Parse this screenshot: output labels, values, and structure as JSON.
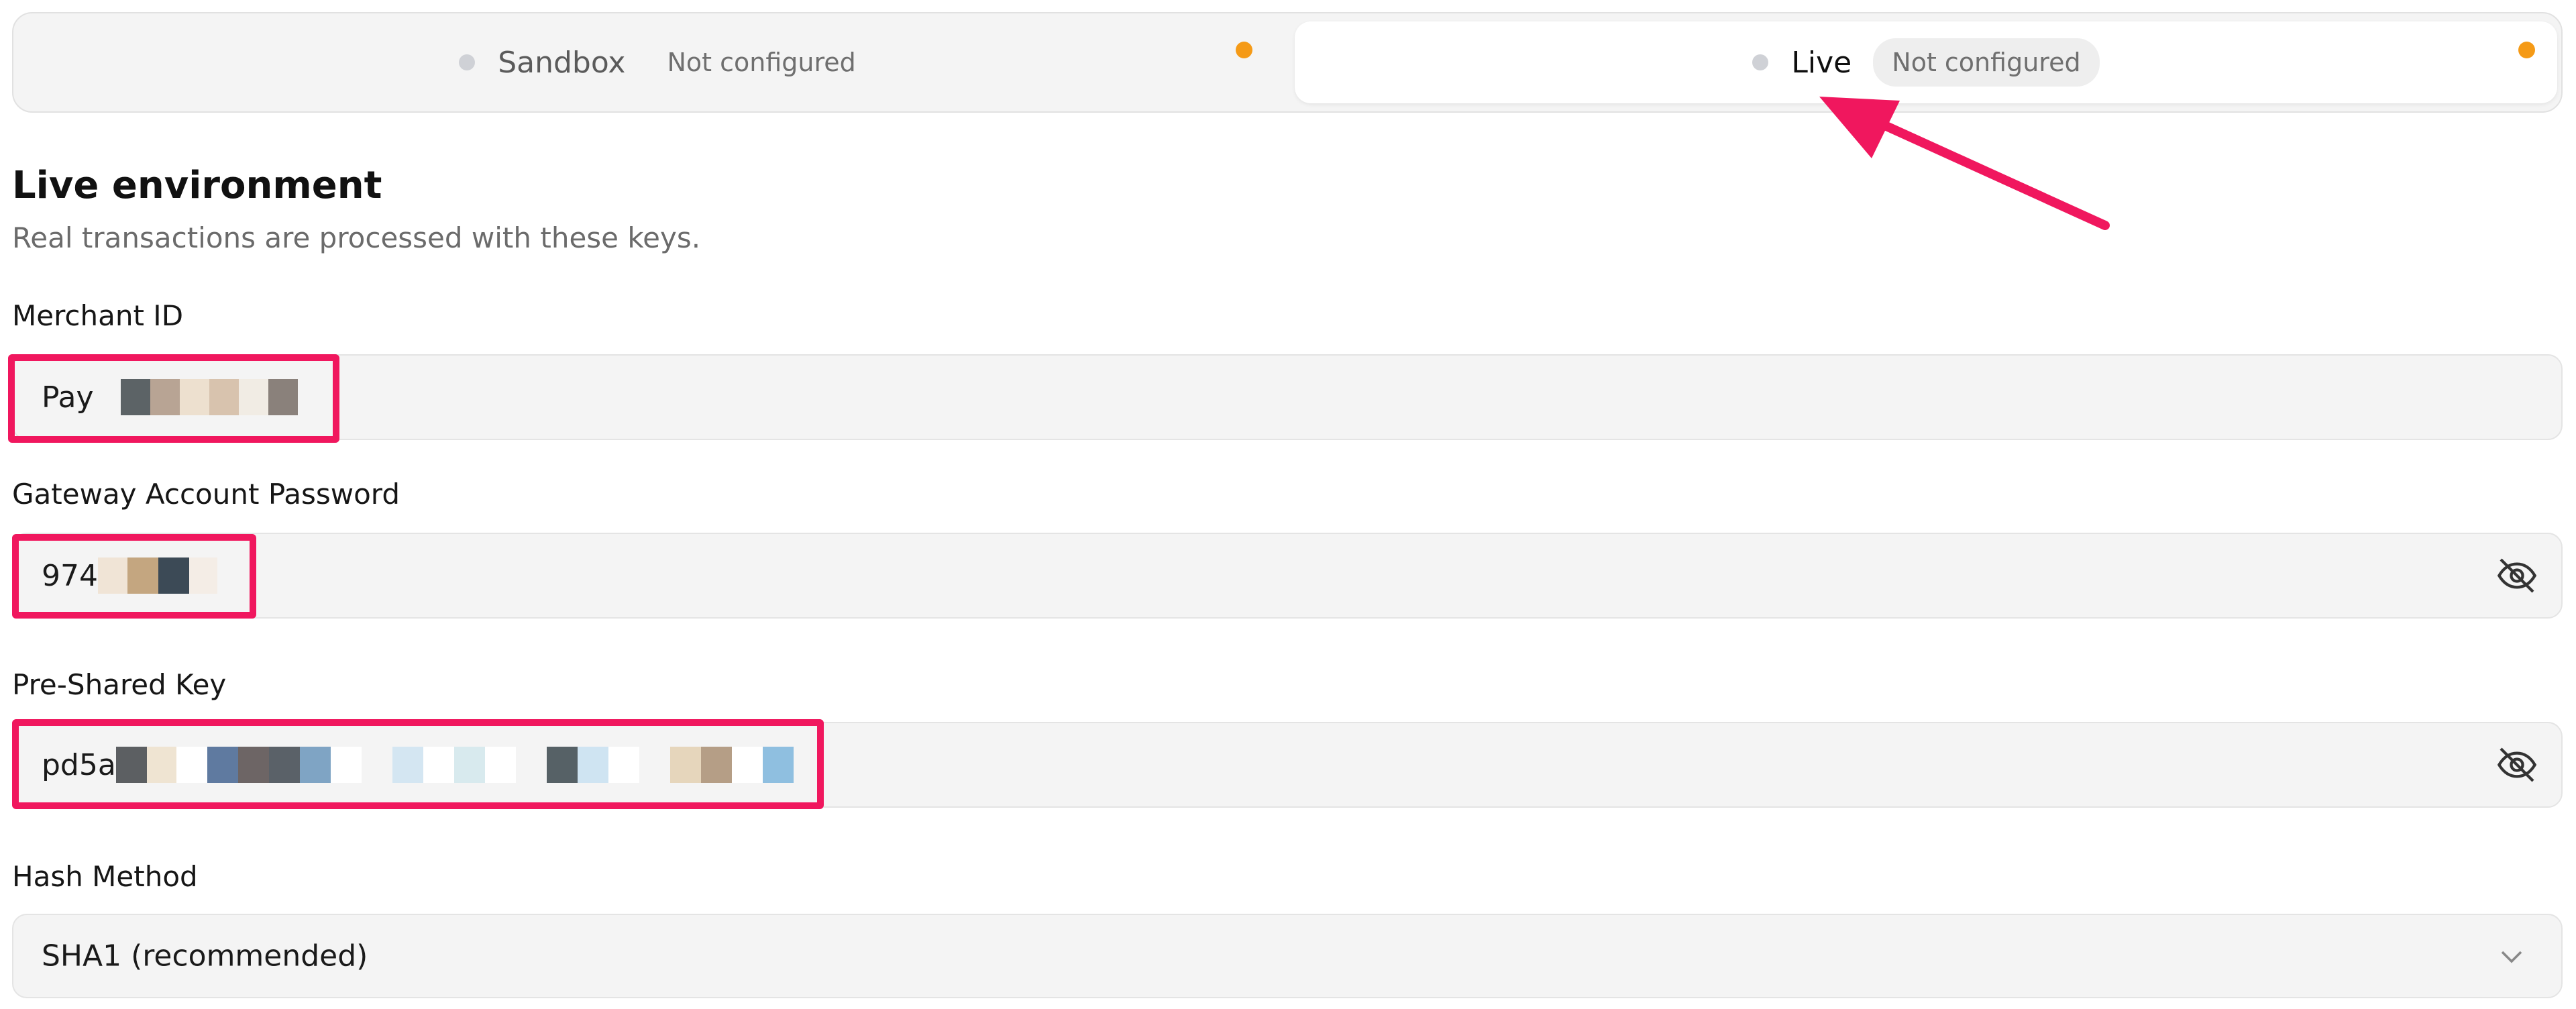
{
  "environments": {
    "sandbox": {
      "label": "Sandbox",
      "status": "Not configured"
    },
    "live": {
      "label": "Live",
      "status": "Not configured",
      "selected": true
    }
  },
  "section": {
    "title": "Live environment",
    "subtitle": "Real transactions are processed with these keys."
  },
  "fields": {
    "merchant_id": {
      "label": "Merchant ID",
      "value_visible": "Pay"
    },
    "gateway_password": {
      "label": "Gateway Account Password",
      "value_visible": "974"
    },
    "pre_shared_key": {
      "label": "Pre-Shared Key",
      "value_visible": "pd5a"
    },
    "hash_method": {
      "label": "Hash Method",
      "value": "SHA1 (recommended)"
    }
  },
  "icons": {
    "status_dot": "status-dot-icon",
    "warning_dot": "warning-dot-icon",
    "visibility_toggle": "eye-off-icon",
    "dropdown": "chevron-down-icon"
  },
  "colors": {
    "accent_warning": "#f59a16",
    "annotation": "#f0175e",
    "field_bg": "#f4f4f4"
  }
}
